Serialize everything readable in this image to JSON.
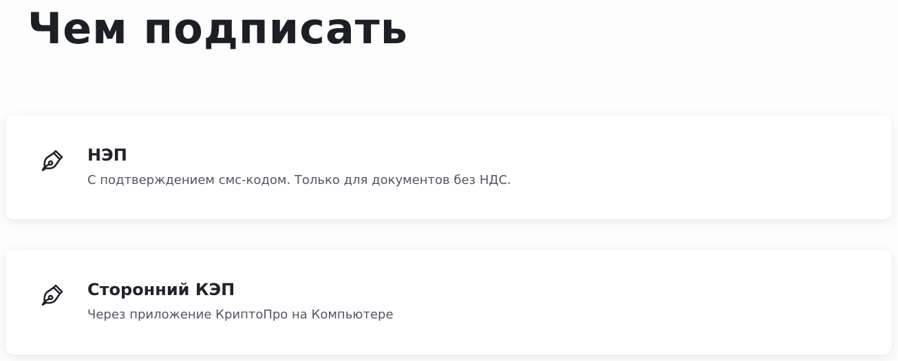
{
  "page": {
    "title": "Чем подписать"
  },
  "options": [
    {
      "icon": "pen-nib-icon",
      "title": "НЭП",
      "subtitle": "С подтверждением смс-кодом. Только для документов без НДС."
    },
    {
      "icon": "pen-nib-icon",
      "title": "Сторонний КЭП",
      "subtitle": "Через приложение КриптоПро на Компьютере"
    }
  ]
}
